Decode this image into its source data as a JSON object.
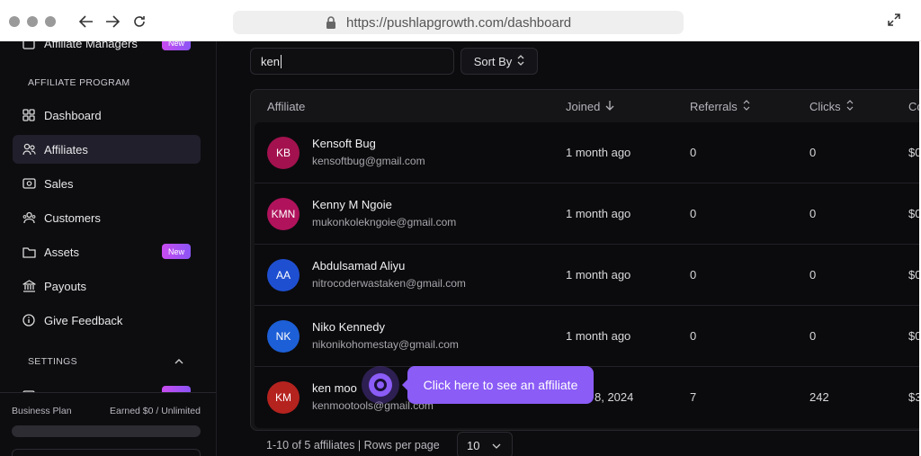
{
  "browser": {
    "url": "https://pushlapgrowth.com/dashboard"
  },
  "sidebar": {
    "top_item": {
      "label": "Affiliate Managers",
      "badge": "New"
    },
    "program_section": "AFFILIATE PROGRAM",
    "items": [
      {
        "label": "Dashboard",
        "icon": "grid-icon"
      },
      {
        "label": "Affiliates",
        "icon": "users-icon",
        "active": true
      },
      {
        "label": "Sales",
        "icon": "money-icon"
      },
      {
        "label": "Customers",
        "icon": "customers-icon"
      },
      {
        "label": "Assets",
        "icon": "folder-icon",
        "badge": "New"
      },
      {
        "label": "Payouts",
        "icon": "bank-icon"
      },
      {
        "label": "Give Feedback",
        "icon": "info-icon"
      }
    ],
    "settings_section": "SETTINGS",
    "plan": {
      "name": "Business Plan",
      "earned": "Earned $0 / Unlimited"
    }
  },
  "toolbar": {
    "search_value": "ken",
    "sort_label": "Sort By"
  },
  "table": {
    "headers": {
      "affiliate": "Affiliate",
      "joined": "Joined",
      "referrals": "Referrals",
      "clicks": "Clicks",
      "commission": "Co"
    },
    "rows": [
      {
        "initials": "KB",
        "avatar_color": "#a3124f",
        "name": "Kensoft Bug",
        "email": "kensoftbug@gmail.com",
        "joined": "1 month ago",
        "referrals": "0",
        "clicks": "0",
        "commission": "$0"
      },
      {
        "initials": "KMN",
        "avatar_color": "#b0135c",
        "name": "Kenny M Ngoie",
        "email": "mukonkolekngoie@gmail.com",
        "joined": "1 month ago",
        "referrals": "0",
        "clicks": "0",
        "commission": "$0"
      },
      {
        "initials": "AA",
        "avatar_color": "#1f4fd1",
        "name": "Abdulsamad Aliyu",
        "email": "nitrocoderwastaken@gmail.com",
        "joined": "1 month ago",
        "referrals": "0",
        "clicks": "0",
        "commission": "$0"
      },
      {
        "initials": "NK",
        "avatar_color": "#1d5fd6",
        "name": "Niko Kennedy",
        "email": "nikonikohomestay@gmail.com",
        "joined": "1 month ago",
        "referrals": "0",
        "clicks": "0",
        "commission": "$0"
      },
      {
        "initials": "KM",
        "avatar_color": "#b5231f",
        "name": "ken moo",
        "email": "kenmootools@gmail.com",
        "joined": "8, 2024",
        "referrals": "7",
        "clicks": "242",
        "commission": "$3"
      }
    ]
  },
  "pagination": {
    "summary": "1-10 of 5 affiliates | Rows per page",
    "rows_per_page": "10"
  },
  "tooltip": {
    "text": "Click here to see an affiliate"
  }
}
